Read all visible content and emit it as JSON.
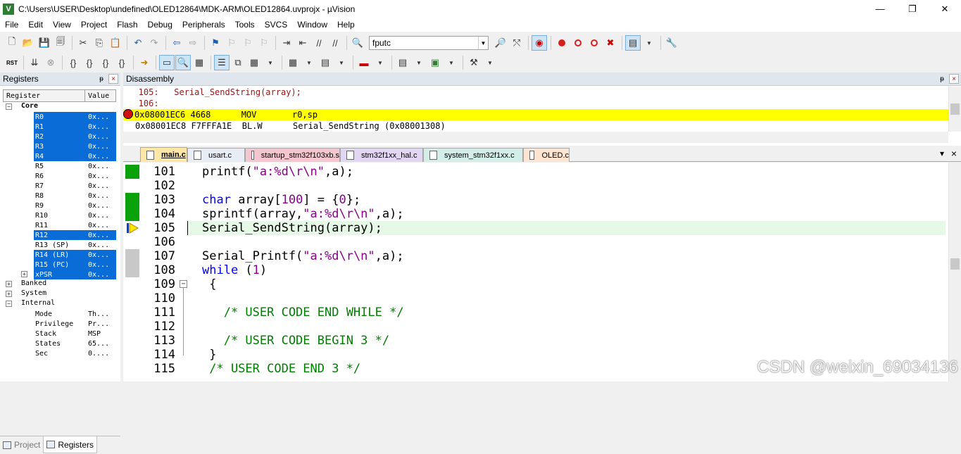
{
  "window": {
    "title": "C:\\Users\\USER\\Desktop\\undefined\\OLED12864\\MDK-ARM\\OLED12864.uvprojx - µVision",
    "app_icon": "V",
    "minimize_icon": "—",
    "maximize_icon": "❐",
    "close_icon": "✕"
  },
  "menu": [
    "File",
    "Edit",
    "View",
    "Project",
    "Flash",
    "Debug",
    "Peripherals",
    "Tools",
    "SVCS",
    "Window",
    "Help"
  ],
  "toolbar": {
    "find_combo_value": "fputc",
    "reset_label": "RST"
  },
  "registers_panel": {
    "title": "Registers",
    "pin_icon": "ᵽ",
    "close_icon": "×",
    "col_register": "Register",
    "col_value": "Value",
    "core_label": "Core",
    "rows": [
      {
        "name": "R0",
        "value": "0x...",
        "selected": true
      },
      {
        "name": "R1",
        "value": "0x...",
        "selected": true
      },
      {
        "name": "R2",
        "value": "0x...",
        "selected": true
      },
      {
        "name": "R3",
        "value": "0x...",
        "selected": true
      },
      {
        "name": "R4",
        "value": "0x...",
        "selected": true
      },
      {
        "name": "R5",
        "value": "0x...",
        "selected": false
      },
      {
        "name": "R6",
        "value": "0x...",
        "selected": false
      },
      {
        "name": "R7",
        "value": "0x...",
        "selected": false
      },
      {
        "name": "R8",
        "value": "0x...",
        "selected": false
      },
      {
        "name": "R9",
        "value": "0x...",
        "selected": false
      },
      {
        "name": "R10",
        "value": "0x...",
        "selected": false
      },
      {
        "name": "R11",
        "value": "0x...",
        "selected": false
      },
      {
        "name": "R12",
        "value": "0x...",
        "selected": true
      },
      {
        "name": "R13 (SP)",
        "value": "0x...",
        "selected": false
      },
      {
        "name": "R14 (LR)",
        "value": "0x...",
        "selected": true
      },
      {
        "name": "R15 (PC)",
        "value": "0x...",
        "selected": true
      },
      {
        "name": "xPSR",
        "value": "0x...",
        "selected": true
      }
    ],
    "banked_label": "Banked",
    "system_label": "System",
    "internal_label": "Internal",
    "internal_rows": [
      {
        "name": "Mode",
        "value": "Th..."
      },
      {
        "name": "Privilege",
        "value": "Pr..."
      },
      {
        "name": "Stack",
        "value": "MSP"
      },
      {
        "name": "States",
        "value": "65..."
      },
      {
        "name": "Sec",
        "value": "0...."
      }
    ],
    "tabs": [
      "Project",
      "Registers"
    ]
  },
  "disassembly_panel": {
    "title": "Disassembly",
    "lines": [
      {
        "text": "   105:   Serial_SendString(array);",
        "kind": "src"
      },
      {
        "text": "   106:",
        "kind": "src"
      },
      {
        "text": "0x08001EC6 4668      MOV       r0,sp",
        "kind": "cur"
      },
      {
        "text": "0x08001EC8 F7FFFA1E  BL.W      Serial_SendString (0x08001308)",
        "kind": "asm"
      }
    ]
  },
  "editor_tabs": [
    {
      "label": "main.c",
      "color": "#ffe7a8",
      "active": true
    },
    {
      "label": "usart.c",
      "color": "#e8ecf4",
      "active": false
    },
    {
      "label": "startup_stm32f103xb.s",
      "color": "#f5c6cf",
      "active": false
    },
    {
      "label": "stm32f1xx_hal.c",
      "color": "#e3d6f2",
      "active": false
    },
    {
      "label": "system_stm32f1xx.c",
      "color": "#d3eee8",
      "active": false
    },
    {
      "label": "OLED.c",
      "color": "#fde4d0",
      "active": false
    }
  ],
  "editor_tab_menu_icon": "▾",
  "editor_close_icon": "×",
  "code_lines": [
    {
      "no": "101",
      "cov": "g",
      "parts": [
        [
          "",
          "printf("
        ],
        [
          "str",
          "\"a:%d\\r\\n\""
        ],
        [
          "",
          ",a);"
        ]
      ]
    },
    {
      "no": "102",
      "cov": "",
      "parts": []
    },
    {
      "no": "103",
      "cov": "g",
      "parts": [
        [
          "kw",
          "char"
        ],
        [
          "",
          " array["
        ],
        [
          "num",
          "100"
        ],
        [
          "",
          "] = {"
        ],
        [
          "num",
          "0"
        ],
        [
          "",
          "};"
        ]
      ]
    },
    {
      "no": "104",
      "cov": "g",
      "parts": [
        [
          "",
          "sprintf(array,"
        ],
        [
          "str",
          "\"a:%d\\r\\n\""
        ],
        [
          "",
          ",a);"
        ]
      ]
    },
    {
      "no": "105",
      "cov": "",
      "current": true,
      "parts": [
        [
          "",
          "Serial_SendString(array);"
        ]
      ]
    },
    {
      "no": "106",
      "cov": "",
      "parts": []
    },
    {
      "no": "107",
      "cov": "s",
      "parts": [
        [
          "",
          "Serial_Printf("
        ],
        [
          "str",
          "\"a:%d\\r\\n\""
        ],
        [
          "",
          ",a);"
        ]
      ]
    },
    {
      "no": "108",
      "cov": "s",
      "parts": [
        [
          "kw",
          "while"
        ],
        [
          "",
          " ("
        ],
        [
          "num",
          "1"
        ],
        [
          "",
          ")"
        ]
      ]
    },
    {
      "no": "109",
      "cov": "",
      "fold": true,
      "parts": [
        [
          "",
          " {"
        ]
      ]
    },
    {
      "no": "110",
      "cov": "",
      "parts": []
    },
    {
      "no": "111",
      "cov": "",
      "parts": [
        [
          "cmt",
          "   /* USER CODE END WHILE */"
        ]
      ]
    },
    {
      "no": "112",
      "cov": "",
      "parts": []
    },
    {
      "no": "113",
      "cov": "",
      "parts": [
        [
          "cmt",
          "   /* USER CODE BEGIN 3 */"
        ]
      ]
    },
    {
      "no": "114",
      "cov": "",
      "parts": [
        [
          "",
          " }"
        ]
      ]
    },
    {
      "no": "115",
      "cov": "",
      "parts": [
        [
          "cmt",
          " /* USER CODE END 3 */"
        ]
      ]
    }
  ],
  "watermark": "CSDN @weixin_69034136"
}
